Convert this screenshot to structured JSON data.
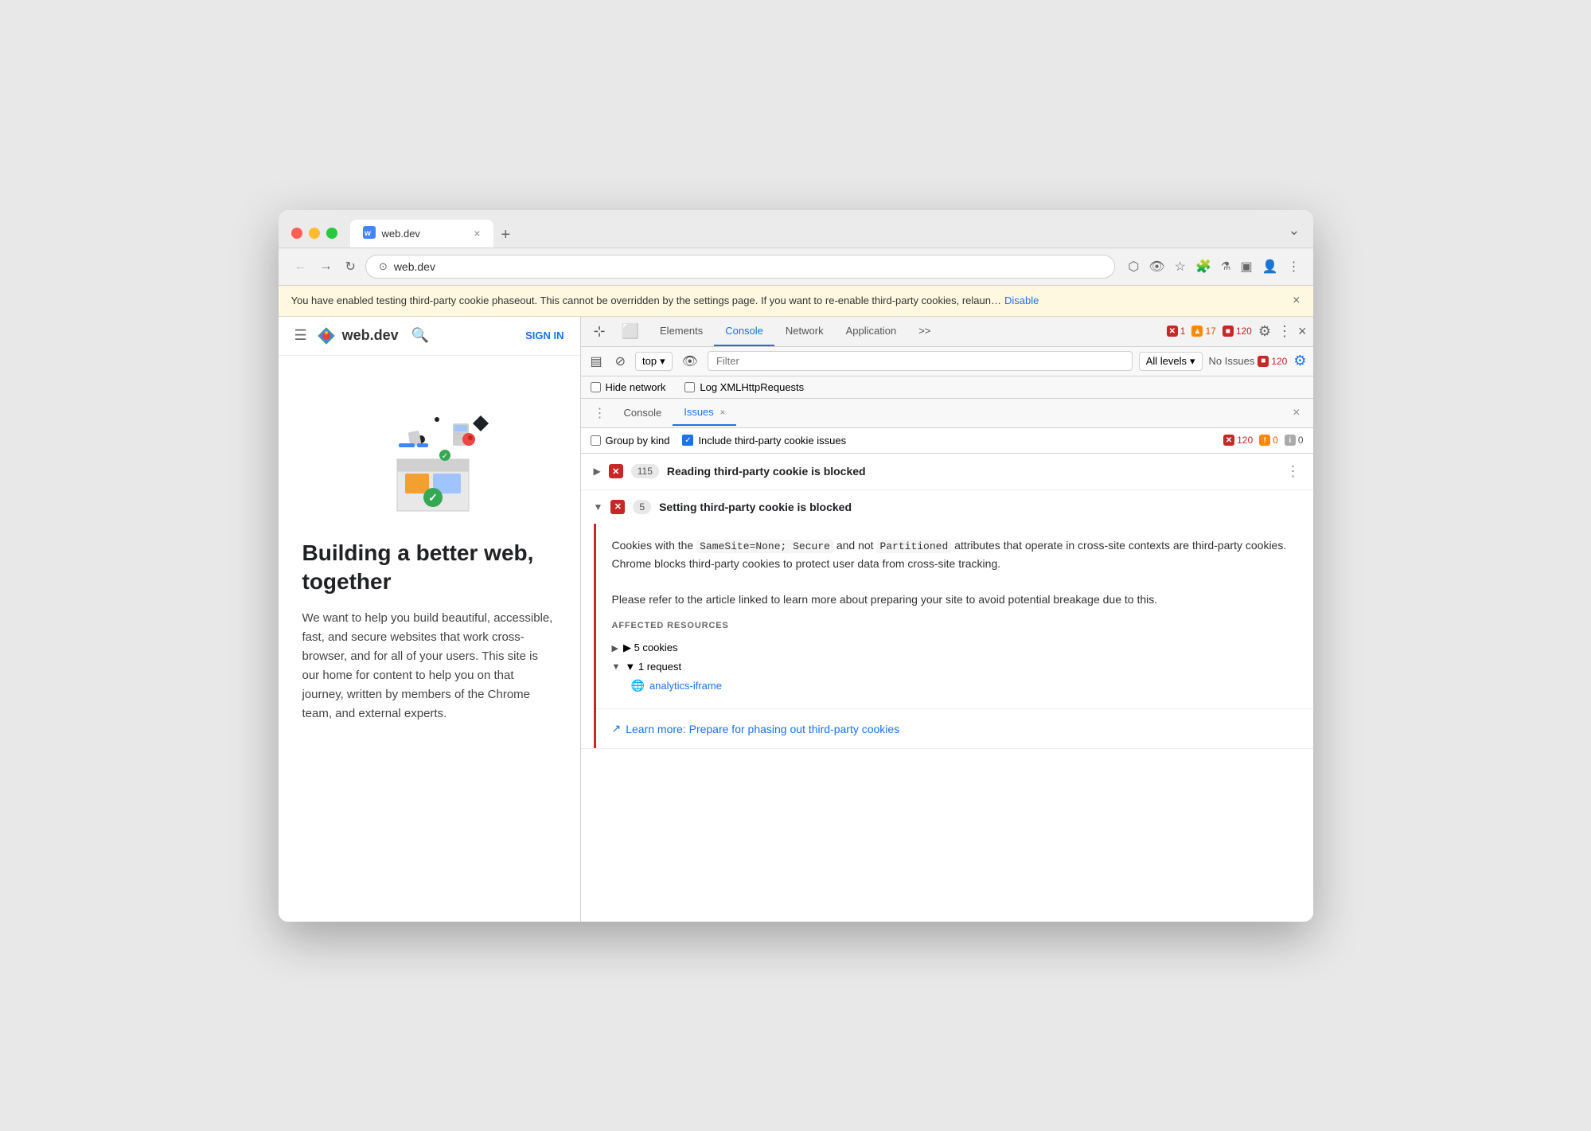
{
  "browser": {
    "tab_title": "web.dev",
    "tab_favicon": "🌐",
    "address": "web.dev",
    "new_tab_label": "+",
    "chevron_down": "⌄"
  },
  "info_bar": {
    "message": "You have enabled testing third-party cookie phaseout. This cannot be overridden by the settings page. If you want to re-enable third-party cookies, relaun…",
    "link_text": "Disable",
    "close_label": "×"
  },
  "website": {
    "site_name": "web.dev",
    "signin_label": "SIGN IN",
    "heading": "Building a better web, together",
    "description": "We want to help you build beautiful, accessible, fast, and secure websites that work cross-browser, and for all of your users. This site is our home for content to help you on that journey, written by members of the Chrome team, and external experts."
  },
  "devtools": {
    "tabs": [
      {
        "label": "Elements",
        "active": false
      },
      {
        "label": "Console",
        "active": true
      },
      {
        "label": "Network",
        "active": false
      },
      {
        "label": "Application",
        "active": false
      },
      {
        "label": ">>",
        "active": false
      }
    ],
    "badges": {
      "errors": "1",
      "warnings": "17",
      "info": "120"
    },
    "settings_icon": "⚙",
    "more_icon": "⋮",
    "close_icon": "×"
  },
  "console_toolbar": {
    "frame_label": "top",
    "filter_placeholder": "Filter",
    "levels_label": "All levels",
    "no_issues_label": "No Issues",
    "no_issues_count": "120"
  },
  "hide_network": {
    "label1": "Hide network",
    "label2": "Log XMLHttpRequests"
  },
  "inner_tabs": {
    "console_label": "Console",
    "issues_label": "Issues",
    "close_label": "×"
  },
  "issues_toolbar": {
    "group_by_kind_label": "Group by kind",
    "include_third_party_label": "Include third-party cookie issues",
    "count": "120",
    "warning_count": "0",
    "info_count": "0"
  },
  "issues": [
    {
      "id": "issue-1",
      "expanded": false,
      "count": "115",
      "title": "Reading third-party cookie is blocked",
      "type": "error"
    },
    {
      "id": "issue-2",
      "expanded": true,
      "count": "5",
      "title": "Setting third-party cookie is blocked",
      "type": "error",
      "body_p1": "Cookies with the ",
      "code1": "SameSite=None; Secure",
      "body_p1b": " and not ",
      "code2": "Partitioned",
      "body_p1c": " attributes that operate in cross-site contexts are third-party cookies. Chrome blocks third-party cookies to protect user data from cross-site tracking.",
      "body_p2": "Please refer to the article linked to learn more about preparing your site to avoid potential breakage due to this.",
      "affected_resources_label": "AFFECTED RESOURCES",
      "cookie_item": "▶ 5 cookies",
      "request_item_collapsed": "▼ 1 request",
      "request_link": "analytics-iframe",
      "learn_more_link_text": "Learn more: Prepare for phasing out third-party cookies"
    }
  ]
}
